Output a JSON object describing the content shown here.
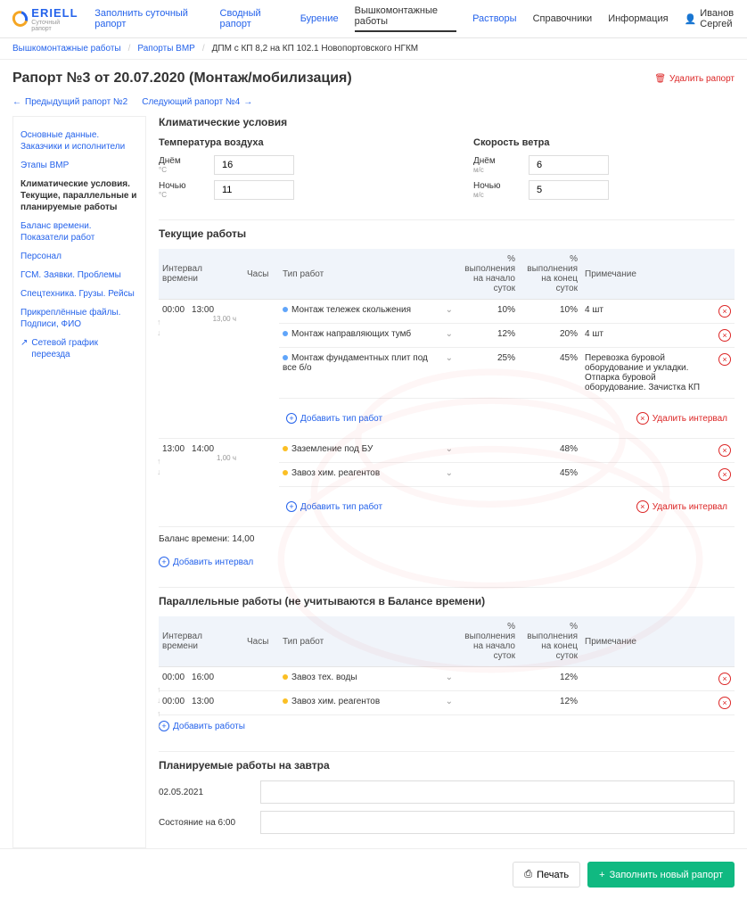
{
  "brand": {
    "name": "ERIELL",
    "sub": "Суточный рапорт"
  },
  "topnav": [
    "Заполнить суточный рапорт",
    "Сводный рапорт",
    "Бурение",
    "Вышкомонтажные работы",
    "Растворы"
  ],
  "topnav_active": 3,
  "right_nav": [
    "Справочники",
    "Информация"
  ],
  "user": "Иванов Сергей",
  "breadcrumb": {
    "a": "Вышкомонтажные работы",
    "b": "Рапорты ВМР",
    "c": "ДПМ с КП 8,2 на КП 102.1 Новопортовского НГКМ"
  },
  "title": "Рапорт №3 от 20.07.2020 (Монтаж/мобилизация)",
  "delete_report": "Удалить рапорт",
  "prev_report": "Предыдущий рапорт №2",
  "next_report": "Следующий рапорт №4",
  "sidebar": [
    "Основные данные. Заказчики и исполнители",
    "Этапы ВМР",
    "Климатические условия. Текущие, параллельные и планируемые работы",
    "Баланс времени. Показатели работ",
    "Персонал",
    "ГСМ. Заявки. Проблемы",
    "Спецтехника. Грузы. Рейсы",
    "Прикреплённые файлы. Подписи, ФИО",
    "Сетевой график переезда"
  ],
  "sidebar_active": 2,
  "climate": {
    "title": "Климатические условия",
    "temp_title": "Температура воздуха",
    "wind_title": "Скорость ветра",
    "day_label": "Днём",
    "day_unit": "°C",
    "night_label": "Ночью",
    "night_unit": "°C",
    "wind_day_unit": "м/с",
    "wind_night_unit": "м/с",
    "temp_day": "16",
    "temp_night": "11",
    "wind_day": "6",
    "wind_night": "5"
  },
  "current": {
    "title": "Текущие работы",
    "cols": {
      "interval": "Интервал времени",
      "hours": "Часы",
      "type": "Тип работ",
      "pct_start": "% выполнения на начало суток",
      "pct_end": "% выполнения на конец суток",
      "note": "Примечание"
    },
    "groups": [
      {
        "from": "00:00",
        "to": "13:00",
        "dur": "13,00 ч",
        "rows": [
          {
            "dot": "blue",
            "type": "Монтаж тележек скольжения",
            "pct_start": "10%",
            "pct_end": "10%",
            "note": "4 шт"
          },
          {
            "dot": "blue",
            "type": "Монтаж направляющих тумб",
            "pct_start": "12%",
            "pct_end": "20%",
            "note": "4 шт"
          },
          {
            "dot": "blue",
            "type": "Монтаж фундаментных плит под все б/о",
            "pct_start": "25%",
            "pct_end": "45%",
            "note": "Перевозка буровой оборудование и укладки. Отпарка буровой оборудование. Зачистка КП"
          }
        ]
      },
      {
        "from": "13:00",
        "to": "14:00",
        "dur": "1,00 ч",
        "rows": [
          {
            "dot": "yellow",
            "type": "Заземление под БУ",
            "pct_start": "",
            "pct_end": "48%",
            "note": ""
          },
          {
            "dot": "yellow",
            "type": "Завоз хим. реагентов",
            "pct_start": "",
            "pct_end": "45%",
            "note": ""
          }
        ]
      }
    ],
    "add_type": "Добавить тип работ",
    "del_interval": "Удалить интервал",
    "balance": "Баланс времени: 14,00",
    "add_interval": "Добавить интервал"
  },
  "parallel": {
    "title": "Параллельные работы (не учитываются в Балансе времени)",
    "rows": [
      {
        "from": "00:00",
        "to": "16:00",
        "dot": "yellow",
        "type": "Завоз тех. воды",
        "pct_start": "",
        "pct_end": "12%",
        "note": ""
      },
      {
        "from": "00:00",
        "to": "13:00",
        "dot": "yellow",
        "type": "Завоз хим. реагентов",
        "pct_start": "",
        "pct_end": "12%",
        "note": ""
      }
    ],
    "add": "Добавить работы"
  },
  "planned": {
    "title": "Планируемые работы на завтра",
    "date": "02.05.2021",
    "state_label": "Состояние на 6:00"
  },
  "footer": {
    "print": "Печать",
    "new": "Заполнить новый рапорт"
  }
}
